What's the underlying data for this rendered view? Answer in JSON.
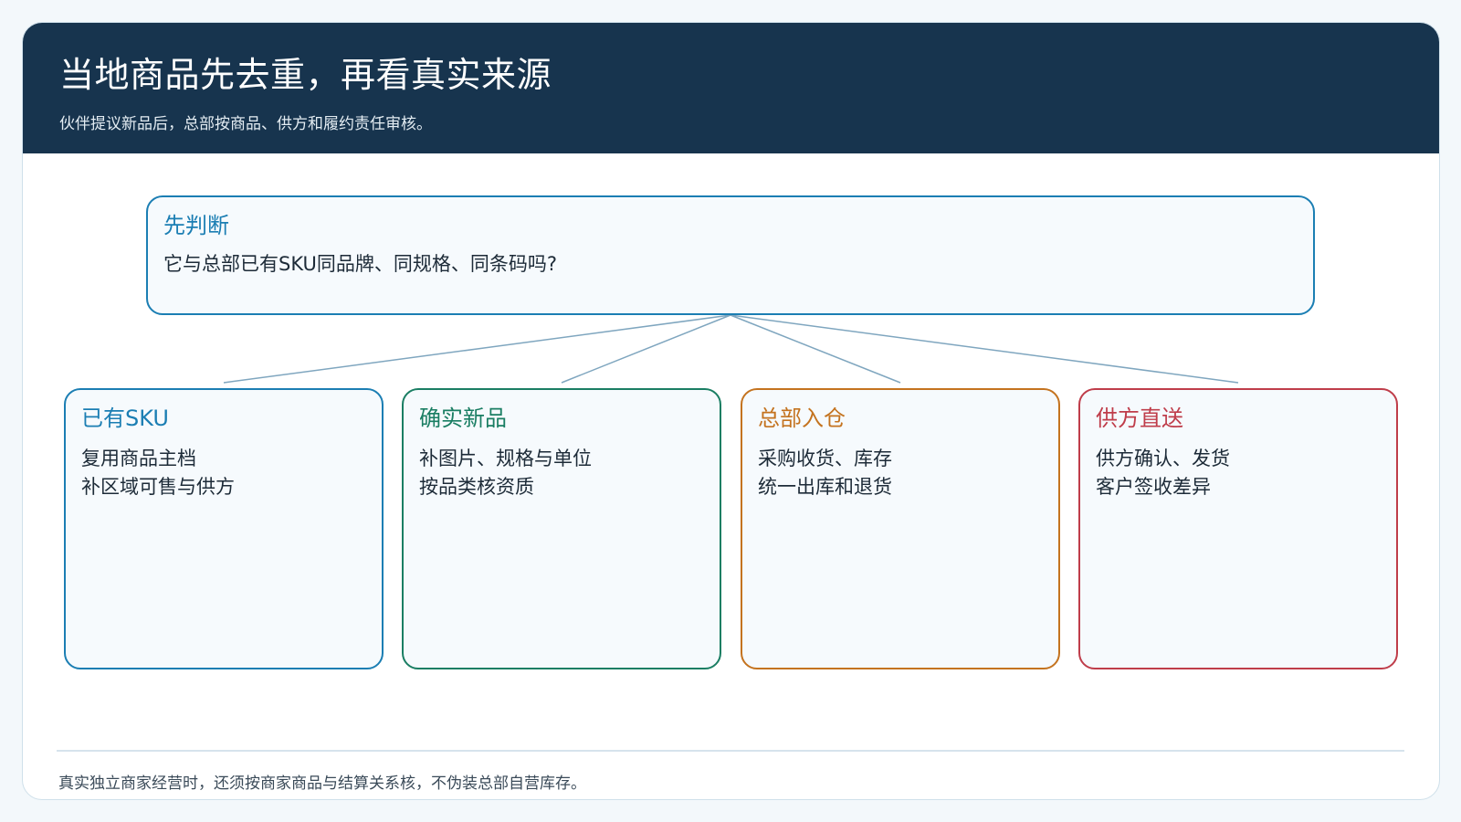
{
  "header": {
    "title": "当地商品先去重，再看真实来源",
    "subtitle": "伙伴提议新品后，总部按商品、供方和履约责任审核。"
  },
  "question": {
    "title": "先判断",
    "text": "它与总部已有SKU同品牌、同规格、同条码吗?"
  },
  "branches": [
    {
      "title": "已有SKU",
      "lines": [
        "复用商品主档",
        "补区域可售与供方"
      ],
      "color": "#1b7eb3"
    },
    {
      "title": "确实新品",
      "lines": [
        "补图片、规格与单位",
        "按品类核资质"
      ],
      "color": "#1a7e63"
    },
    {
      "title": "总部入仓",
      "lines": [
        "采购收货、库存",
        "统一出库和退货"
      ],
      "color": "#c4731f"
    },
    {
      "title": "供方直送",
      "lines": [
        "供方确认、发货",
        "客户签收差异"
      ],
      "color": "#bf3d4a"
    }
  ],
  "footnote": "真实独立商家经营时，还须按商家商品与结算关系核，不伪装总部自营库存。",
  "colors": {
    "header_bg": "#17344e",
    "connector": "#7fa6bf"
  }
}
